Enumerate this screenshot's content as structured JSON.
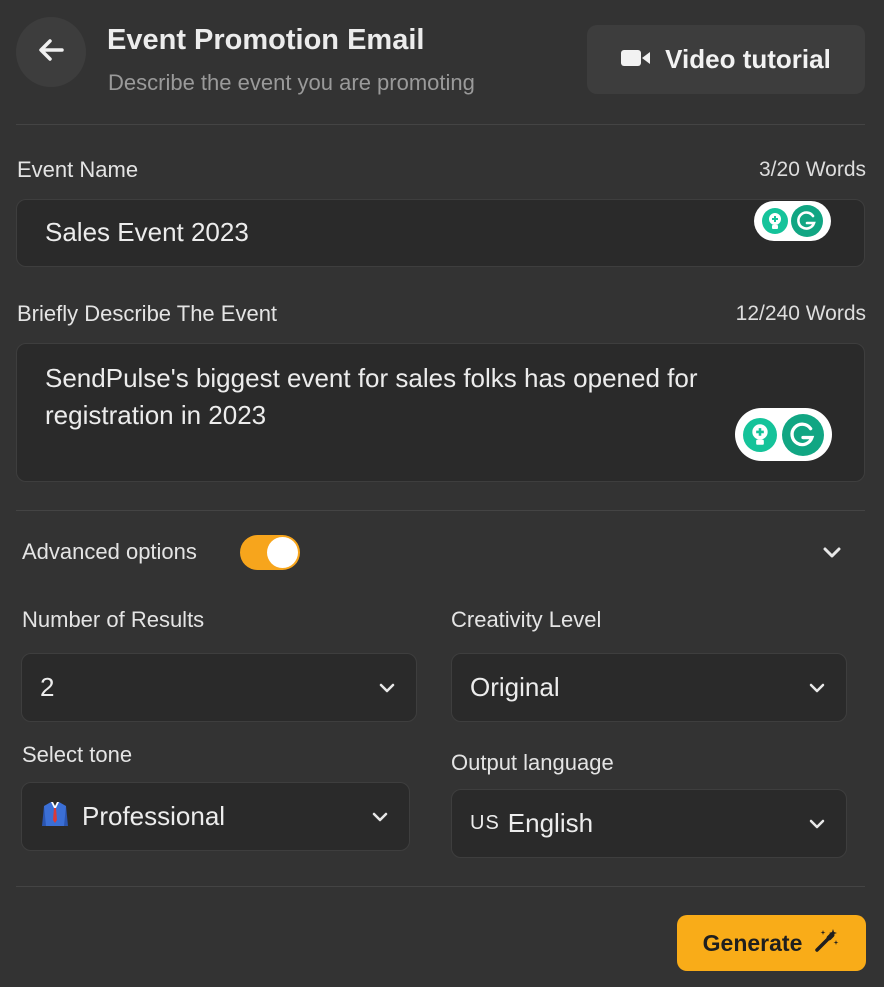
{
  "header": {
    "title": "Event Promotion Email",
    "subtitle": "Describe the event you are promoting",
    "video_label": "Video tutorial"
  },
  "event_name": {
    "label": "Event Name",
    "count": "3/20 Words",
    "value": "Sales Event 2023"
  },
  "description": {
    "label": "Briefly Describe The Event",
    "count": "12/240 Words",
    "value": "SendPulse's biggest event for sales folks has opened for registration in 2023"
  },
  "advanced": {
    "label": "Advanced options",
    "enabled": true
  },
  "options": {
    "results_label": "Number of Results",
    "results_value": "2",
    "creativity_label": "Creativity Level",
    "creativity_value": "Original",
    "tone_label": "Select tone",
    "tone_value": "Professional",
    "language_label": "Output language",
    "language_flag": "US",
    "language_value": "English"
  },
  "actions": {
    "generate_label": "Generate"
  },
  "colors": {
    "accent": "#f9ac18",
    "background": "#333333",
    "field": "#2a2a2a",
    "grammarly": "#15c39a"
  }
}
